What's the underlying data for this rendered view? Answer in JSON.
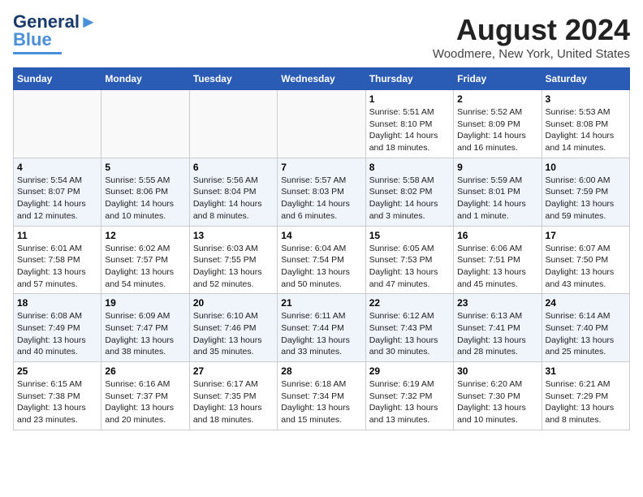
{
  "header": {
    "logo_line1": "General",
    "logo_line2": "Blue",
    "title": "August 2024",
    "subtitle": "Woodmere, New York, United States"
  },
  "columns": [
    "Sunday",
    "Monday",
    "Tuesday",
    "Wednesday",
    "Thursday",
    "Friday",
    "Saturday"
  ],
  "weeks": [
    [
      {
        "day": "",
        "info": ""
      },
      {
        "day": "",
        "info": ""
      },
      {
        "day": "",
        "info": ""
      },
      {
        "day": "",
        "info": ""
      },
      {
        "day": "1",
        "info": "Sunrise: 5:51 AM\nSunset: 8:10 PM\nDaylight: 14 hours\nand 18 minutes."
      },
      {
        "day": "2",
        "info": "Sunrise: 5:52 AM\nSunset: 8:09 PM\nDaylight: 14 hours\nand 16 minutes."
      },
      {
        "day": "3",
        "info": "Sunrise: 5:53 AM\nSunset: 8:08 PM\nDaylight: 14 hours\nand 14 minutes."
      }
    ],
    [
      {
        "day": "4",
        "info": "Sunrise: 5:54 AM\nSunset: 8:07 PM\nDaylight: 14 hours\nand 12 minutes."
      },
      {
        "day": "5",
        "info": "Sunrise: 5:55 AM\nSunset: 8:06 PM\nDaylight: 14 hours\nand 10 minutes."
      },
      {
        "day": "6",
        "info": "Sunrise: 5:56 AM\nSunset: 8:04 PM\nDaylight: 14 hours\nand 8 minutes."
      },
      {
        "day": "7",
        "info": "Sunrise: 5:57 AM\nSunset: 8:03 PM\nDaylight: 14 hours\nand 6 minutes."
      },
      {
        "day": "8",
        "info": "Sunrise: 5:58 AM\nSunset: 8:02 PM\nDaylight: 14 hours\nand 3 minutes."
      },
      {
        "day": "9",
        "info": "Sunrise: 5:59 AM\nSunset: 8:01 PM\nDaylight: 14 hours\nand 1 minute."
      },
      {
        "day": "10",
        "info": "Sunrise: 6:00 AM\nSunset: 7:59 PM\nDaylight: 13 hours\nand 59 minutes."
      }
    ],
    [
      {
        "day": "11",
        "info": "Sunrise: 6:01 AM\nSunset: 7:58 PM\nDaylight: 13 hours\nand 57 minutes."
      },
      {
        "day": "12",
        "info": "Sunrise: 6:02 AM\nSunset: 7:57 PM\nDaylight: 13 hours\nand 54 minutes."
      },
      {
        "day": "13",
        "info": "Sunrise: 6:03 AM\nSunset: 7:55 PM\nDaylight: 13 hours\nand 52 minutes."
      },
      {
        "day": "14",
        "info": "Sunrise: 6:04 AM\nSunset: 7:54 PM\nDaylight: 13 hours\nand 50 minutes."
      },
      {
        "day": "15",
        "info": "Sunrise: 6:05 AM\nSunset: 7:53 PM\nDaylight: 13 hours\nand 47 minutes."
      },
      {
        "day": "16",
        "info": "Sunrise: 6:06 AM\nSunset: 7:51 PM\nDaylight: 13 hours\nand 45 minutes."
      },
      {
        "day": "17",
        "info": "Sunrise: 6:07 AM\nSunset: 7:50 PM\nDaylight: 13 hours\nand 43 minutes."
      }
    ],
    [
      {
        "day": "18",
        "info": "Sunrise: 6:08 AM\nSunset: 7:49 PM\nDaylight: 13 hours\nand 40 minutes."
      },
      {
        "day": "19",
        "info": "Sunrise: 6:09 AM\nSunset: 7:47 PM\nDaylight: 13 hours\nand 38 minutes."
      },
      {
        "day": "20",
        "info": "Sunrise: 6:10 AM\nSunset: 7:46 PM\nDaylight: 13 hours\nand 35 minutes."
      },
      {
        "day": "21",
        "info": "Sunrise: 6:11 AM\nSunset: 7:44 PM\nDaylight: 13 hours\nand 33 minutes."
      },
      {
        "day": "22",
        "info": "Sunrise: 6:12 AM\nSunset: 7:43 PM\nDaylight: 13 hours\nand 30 minutes."
      },
      {
        "day": "23",
        "info": "Sunrise: 6:13 AM\nSunset: 7:41 PM\nDaylight: 13 hours\nand 28 minutes."
      },
      {
        "day": "24",
        "info": "Sunrise: 6:14 AM\nSunset: 7:40 PM\nDaylight: 13 hours\nand 25 minutes."
      }
    ],
    [
      {
        "day": "25",
        "info": "Sunrise: 6:15 AM\nSunset: 7:38 PM\nDaylight: 13 hours\nand 23 minutes."
      },
      {
        "day": "26",
        "info": "Sunrise: 6:16 AM\nSunset: 7:37 PM\nDaylight: 13 hours\nand 20 minutes."
      },
      {
        "day": "27",
        "info": "Sunrise: 6:17 AM\nSunset: 7:35 PM\nDaylight: 13 hours\nand 18 minutes."
      },
      {
        "day": "28",
        "info": "Sunrise: 6:18 AM\nSunset: 7:34 PM\nDaylight: 13 hours\nand 15 minutes."
      },
      {
        "day": "29",
        "info": "Sunrise: 6:19 AM\nSunset: 7:32 PM\nDaylight: 13 hours\nand 13 minutes."
      },
      {
        "day": "30",
        "info": "Sunrise: 6:20 AM\nSunset: 7:30 PM\nDaylight: 13 hours\nand 10 minutes."
      },
      {
        "day": "31",
        "info": "Sunrise: 6:21 AM\nSunset: 7:29 PM\nDaylight: 13 hours\nand 8 minutes."
      }
    ]
  ]
}
